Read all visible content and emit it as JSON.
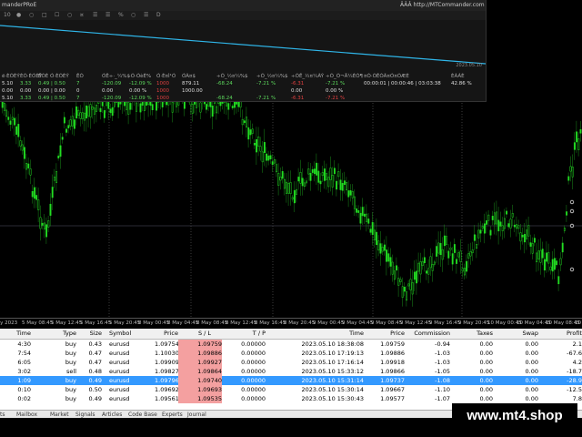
{
  "panel": {
    "title": "manderPRoE",
    "url": "ÂÂÂ http://MTCommander.com",
    "tools": [
      "10",
      "●",
      "○",
      "□",
      "☐",
      "○",
      "¤",
      "☰",
      "☰",
      "%",
      "○",
      "☰",
      "D"
    ],
    "mini_date": "2023.05.10",
    "columns": [
      {
        "head": "ë·ÈÓÈÝ",
        "cells": [
          {
            "t": "5.10",
            "c": "w"
          },
          {
            "t": "0.00",
            "c": "w"
          },
          {
            "t": "5.10",
            "c": "w"
          }
        ]
      },
      {
        "head": "ÈÓ·ÈÓÈÝ",
        "cells": [
          {
            "t": "3.33",
            "c": "g"
          },
          {
            "t": "0.00",
            "c": "w"
          },
          {
            "t": "3.33",
            "c": "g"
          }
        ]
      },
      {
        "head": "ÊÓÈ Ó·ÈÓÈÝ",
        "cells": [
          {
            "t": "0.49 | 0.50",
            "c": "g"
          },
          {
            "t": "0.00 | 0.00",
            "c": "w"
          },
          {
            "t": "0.49 | 0.50",
            "c": "g"
          }
        ]
      },
      {
        "head": "ÊÓ",
        "cells": [
          {
            "t": "7",
            "c": "g"
          },
          {
            "t": "0",
            "c": "w"
          },
          {
            "t": "7",
            "c": "g"
          }
        ]
      },
      {
        "head": "ÓÊ÷·_¼%$",
        "cells": [
          {
            "t": "-120.09",
            "c": "g"
          },
          {
            "t": "0.00",
            "c": "w"
          },
          {
            "t": "-120.09",
            "c": "g"
          }
        ]
      },
      {
        "head": "·Ó·ÓèÈ%",
        "cells": [
          {
            "t": "-12.09 %",
            "c": "g"
          },
          {
            "t": "0.00 %",
            "c": "w"
          },
          {
            "t": "-12.09 %",
            "c": "g"
          }
        ]
      },
      {
        "head": "Ó·È¤Ì¹Ó",
        "cells": [
          {
            "t": "1000",
            "c": "r"
          },
          {
            "t": "1000",
            "c": "r"
          },
          {
            "t": "1000",
            "c": "r"
          }
        ]
      },
      {
        "head": "ÓÀ¤$",
        "cells": [
          {
            "t": "879.11",
            "c": "w"
          },
          {
            "t": "1000.00",
            "c": "w"
          },
          {
            "t": "",
            "c": "w"
          }
        ]
      },
      {
        "head": "÷Ó_½¤¼%$",
        "cells": [
          {
            "t": "-68.24",
            "c": "g"
          },
          {
            "t": "",
            "c": "w"
          },
          {
            "t": "-68.24",
            "c": "g"
          }
        ]
      },
      {
        "head": "÷Ó_½¤¼%$",
        "cells": [
          {
            "t": "-7.21 %",
            "c": "g"
          },
          {
            "t": "",
            "c": "w"
          },
          {
            "t": "-7.21 %",
            "c": "g"
          }
        ]
      },
      {
        "head": "÷ÓÊ_½¤¼ÀÝ",
        "cells": [
          {
            "t": "-6.31",
            "c": "r"
          },
          {
            "t": "0.00",
            "c": "w"
          },
          {
            "t": "-6.31",
            "c": "r"
          }
        ]
      },
      {
        "head": "÷Ó_Ó¬Ä¼ÈÓ¶",
        "cells": [
          {
            "t": "-7.21 %",
            "c": "g"
          },
          {
            "t": "0.00 %",
            "c": "w"
          },
          {
            "t": "-7.21 %",
            "c": "r"
          }
        ]
      },
      {
        "head": "¤Ó·ÓÊÓÃ¤Ó¤ÓÆÈ",
        "cells": [
          {
            "t": "00:00:01 | 00:00:46 | 03:03:38",
            "c": "w"
          },
          {
            "t": "",
            "c": "w"
          },
          {
            "t": "",
            "c": "w"
          }
        ]
      },
      {
        "head": "ÈÀÁÈ",
        "cells": [
          {
            "t": "42.86 %",
            "c": "w"
          },
          {
            "t": "",
            "c": "w"
          },
          {
            "t": "",
            "c": "w"
          }
        ]
      }
    ]
  },
  "axis": {
    "labels": [
      "May 2023",
      "5 May 08:45",
      "5 May 12:45",
      "5 May 16:45",
      "5 May 20:45",
      "8 May 00:45",
      "8 May 04:45",
      "8 May 08:45",
      "8 May 12:45",
      "8 May 16:45",
      "8 May 20:45",
      "9 May 00:45",
      "9 May 04:45",
      "9 May 08:45",
      "9 May 12:45",
      "9 May 16:45",
      "9 May 20:45",
      "10 May 00:45",
      "10 May 04:45",
      "10 May 08:45",
      "10 May 12:45"
    ]
  },
  "table": {
    "headers": [
      "Time",
      "Type",
      "Size",
      "Symbol",
      "Price",
      "S / L",
      "T / P",
      "Time",
      "Price",
      "Commission",
      "Taxes",
      "Swap",
      "Profit"
    ],
    "rows": [
      [
        "4:30",
        "buy",
        "0.43",
        "eurusd",
        "1.09754",
        "1.09759",
        "0.00000",
        "2023.05.10 18:38:08",
        "1.09759",
        "-0.94",
        "0.00",
        "0.00",
        "2.1"
      ],
      [
        "7:54",
        "buy",
        "0.47",
        "eurusd",
        "1.10030",
        "1.09886",
        "0.00000",
        "2023.05.10 17:19:13",
        "1.09886",
        "-1.03",
        "0.00",
        "0.00",
        "-67.6"
      ],
      [
        "6:05",
        "buy",
        "0.47",
        "eurusd",
        "1.09909",
        "1.09927",
        "0.00000",
        "2023.05.10 17:16:14",
        "1.09918",
        "-1.03",
        "0.00",
        "0.00",
        "4.2"
      ],
      [
        "3:02",
        "sell",
        "0.48",
        "eurusd",
        "1.09827",
        "1.09864",
        "0.00000",
        "2023.05.10 15:33:12",
        "1.09866",
        "-1.05",
        "0.00",
        "0.00",
        "-18.7"
      ],
      [
        "1:09",
        "buy",
        "0.49",
        "eurusd",
        "1.09796",
        "1.09740",
        "0.00000",
        "2023.05.10 15:31:14",
        "1.09737",
        "-1.08",
        "0.00",
        "0.00",
        "-28.9"
      ],
      [
        "0:10",
        "buy",
        "0.50",
        "eurusd",
        "1.09692",
        "1.09693",
        "0.00000",
        "2023.05.10 15:30:14",
        "1.09667",
        "-1.10",
        "0.00",
        "0.00",
        "-12.5"
      ],
      [
        "0:02",
        "buy",
        "0.49",
        "eurusd",
        "1.09561",
        "1.09535",
        "0.00000",
        "2023.05.10 15:30:43",
        "1.09577",
        "-1.07",
        "0.00",
        "0.00",
        "7.8"
      ]
    ],
    "selected_row": 4
  },
  "tabs": [
    "ts",
    "Mailbox",
    "Market",
    "Signals",
    "Articles",
    "Code Base",
    "Experts",
    "Journal"
  ],
  "brand": "www.mt4.shop",
  "colors": {
    "bull": "#22dd22",
    "bear": "#22aa22",
    "line": "#2fb5e8",
    "selected": "#3399ff",
    "sl": "#f4a0a0"
  }
}
